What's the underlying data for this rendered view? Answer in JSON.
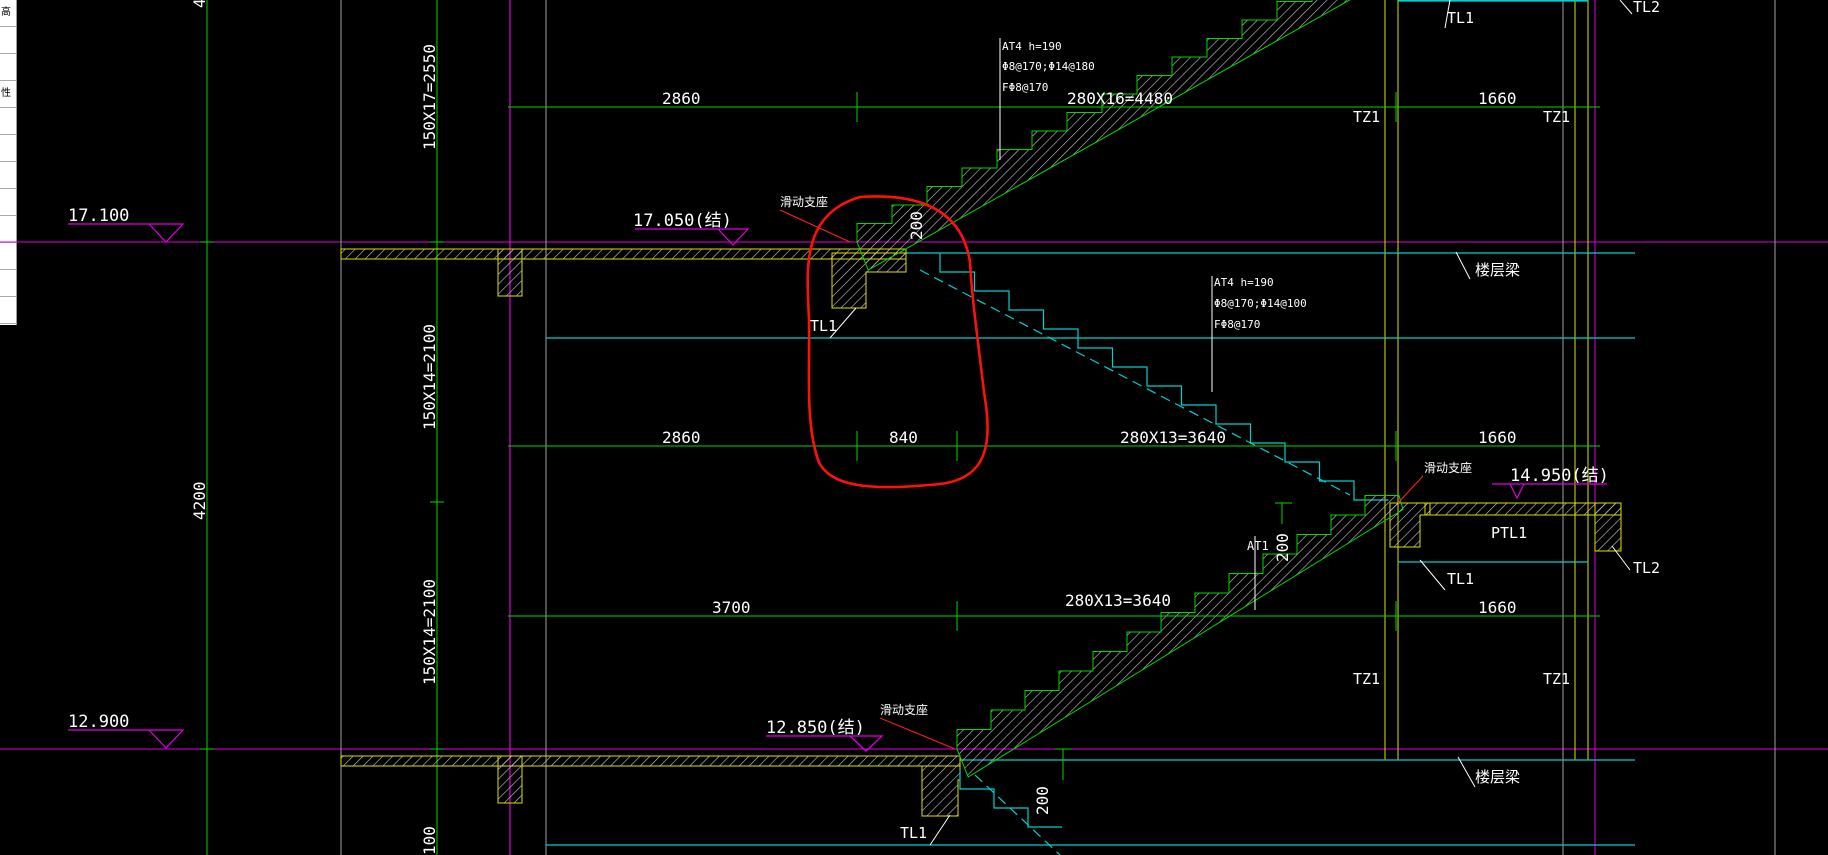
{
  "panel": {
    "rows": [
      "高",
      "",
      "",
      "性",
      "",
      "",
      "",
      "",
      "",
      "",
      "",
      ""
    ]
  },
  "colors": {
    "bg": "#000000",
    "dim": "#00d800",
    "axis": "#e000e0",
    "cyan": "#00d0d0",
    "yellow": "#e0e000",
    "white": "#ffffff",
    "red": "#ff2020",
    "hatch": "#c8c8c8"
  },
  "elevations": {
    "el_1": "17.100",
    "el_2": "17.050(结)",
    "el_3": "14.950(结)",
    "el_4": "12.900",
    "el_5": "12.850(结)"
  },
  "vertical_dims": {
    "v1": "150X17=2550",
    "v2": "150X14=2100",
    "v3": "150X14=2100",
    "v4": "4200",
    "v5": "100",
    "v_top": "4"
  },
  "horizontal_dims": {
    "r1_a": "2860",
    "r1_b": "280X16=4480",
    "r1_c": "1660",
    "r2_a": "2860",
    "r2_b": "840",
    "r2_c": "280X13=3640",
    "r2_d": "1660",
    "r3_a": "3700",
    "r3_b": "280X13=3640",
    "r3_c": "1660"
  },
  "heights": {
    "h1": "200",
    "h2": "200",
    "h3": "200"
  },
  "labels": {
    "tl1_top": "TL1",
    "tl2_top": "TL2",
    "tz1_a": "TZ1",
    "tz1_b": "TZ1",
    "tz1_c": "TZ1",
    "tz1_d": "TZ1",
    "tl1_mid": "TL1",
    "ptl1": "PTL1",
    "tl1_right": "TL1",
    "tl2_right": "TL2",
    "tl1_bot": "TL1",
    "floor_beam_1": "楼层梁",
    "floor_beam_2": "楼层梁",
    "slide_1": "滑动支座",
    "slide_2": "滑动支座",
    "slide_3": "滑动支座",
    "at1": "AT1"
  },
  "notes": {
    "n1_1": "AT4  h=190",
    "n1_2": "Φ8@170;Φ14@180",
    "n1_3": "FΦ8@170",
    "n2_1": "AT4  h=190",
    "n2_2": "Φ8@170;Φ14@100",
    "n2_3": "FΦ8@170"
  }
}
